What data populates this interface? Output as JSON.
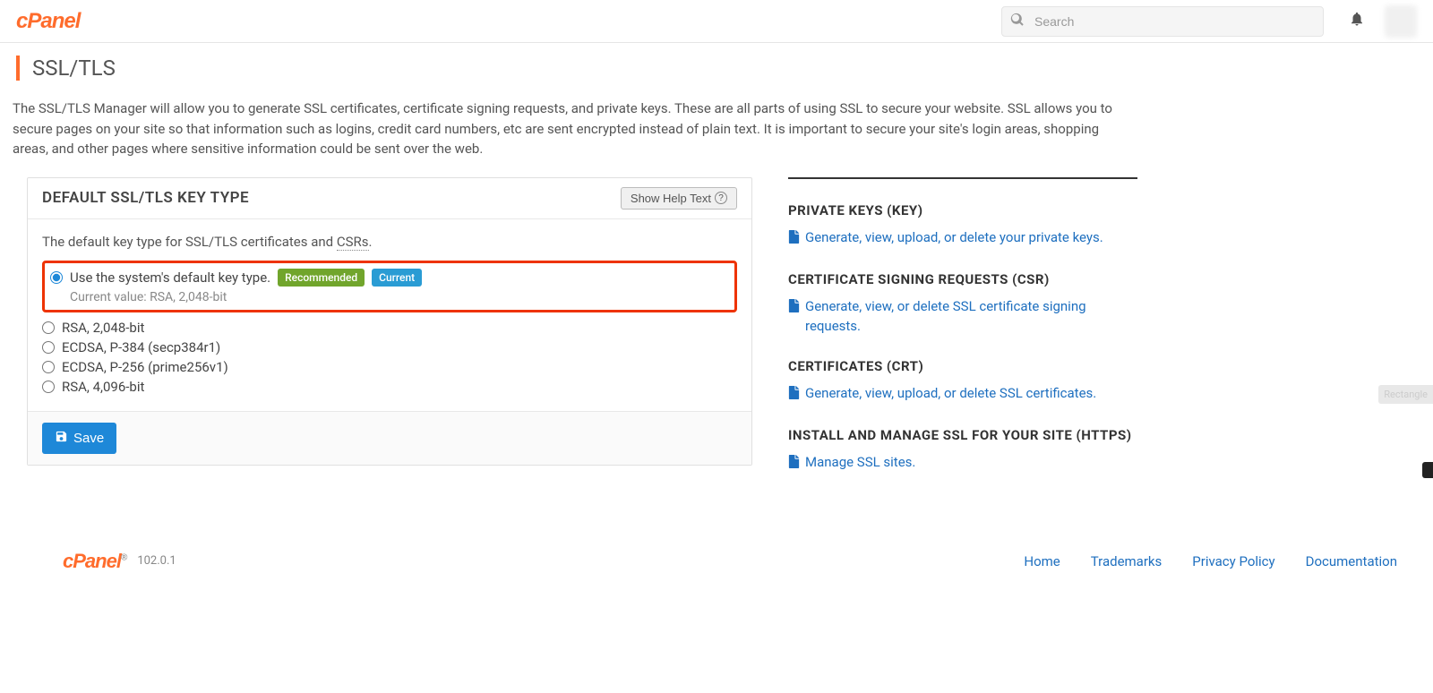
{
  "header": {
    "logo": "cPanel",
    "search_placeholder": "Search"
  },
  "page": {
    "title": "SSL/TLS",
    "description": "The SSL/TLS Manager will allow you to generate SSL certificates, certificate signing requests, and private keys. These are all parts of using SSL to secure your website. SSL allows you to secure pages on your site so that information such as logins, credit card numbers, etc are sent encrypted instead of plain text. It is important to secure your site's login areas, shopping areas, and other pages where sensitive information could be sent over the web."
  },
  "panel": {
    "title": "DEFAULT SSL/TLS KEY TYPE",
    "help_label": "Show Help Text",
    "intro_prefix": "The default key type for SSL/TLS certificates and ",
    "intro_dotted": "CSRs",
    "intro_suffix": ".",
    "badge_recommended": "Recommended",
    "badge_current": "Current",
    "options": {
      "o0_label": "Use the system's default key type.",
      "o0_sub": "Current value: RSA, 2,048-bit",
      "o1_label": "RSA, 2,048-bit",
      "o2_label": "ECDSA, P-384 (secp384r1)",
      "o3_label": "ECDSA, P-256 (prime256v1)",
      "o4_label": "RSA, 4,096-bit"
    },
    "save_label": "Save"
  },
  "sidebar": {
    "s0_title": "PRIVATE KEYS (KEY)",
    "s0_link": "Generate, view, upload, or delete your private keys.",
    "s1_title": "CERTIFICATE SIGNING REQUESTS (CSR)",
    "s1_link": "Generate, view, or delete SSL certificate signing requests.",
    "s2_title": "CERTIFICATES (CRT)",
    "s2_link": "Generate, view, upload, or delete SSL certificates.",
    "s3_title": "INSTALL AND MANAGE SSL FOR YOUR SITE (HTTPS)",
    "s3_link": "Manage SSL sites."
  },
  "float_tag": "Rectangle",
  "footer": {
    "logo": "cPanel",
    "version": "102.0.1",
    "links": {
      "home": "Home",
      "trademarks": "Trademarks",
      "privacy": "Privacy Policy",
      "docs": "Documentation"
    }
  }
}
